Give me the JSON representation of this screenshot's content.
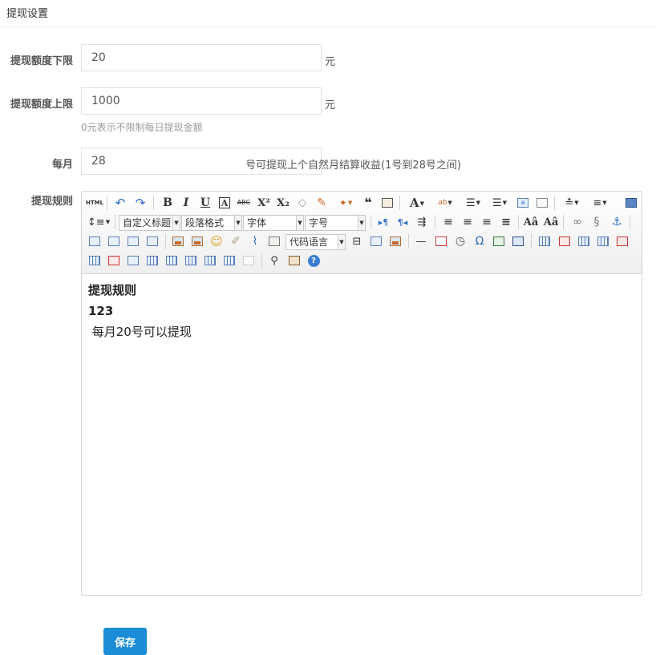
{
  "page": {
    "title": "提现设置"
  },
  "form": {
    "min": {
      "label": "提现额度下限",
      "value": "20",
      "unit": "元"
    },
    "max": {
      "label": "提现额度上限",
      "value": "1000",
      "unit": "元",
      "hint": "0元表示不限制每日提现金额"
    },
    "monthly": {
      "label": "每月",
      "value": "28",
      "suffix": "号可提现上个自然月结算收益(1号到28号之间)"
    },
    "rules": {
      "label": "提现规则"
    }
  },
  "editor": {
    "combos": {
      "custom_title": "自定义标题",
      "paragraph": "段落格式",
      "font": "字体",
      "size": "字号",
      "code_lang": "代码语言"
    },
    "content": {
      "heading": "提现规则",
      "line2": "123",
      "line3": " 每月20号可以提现"
    }
  },
  "actions": {
    "save": "保存"
  }
}
